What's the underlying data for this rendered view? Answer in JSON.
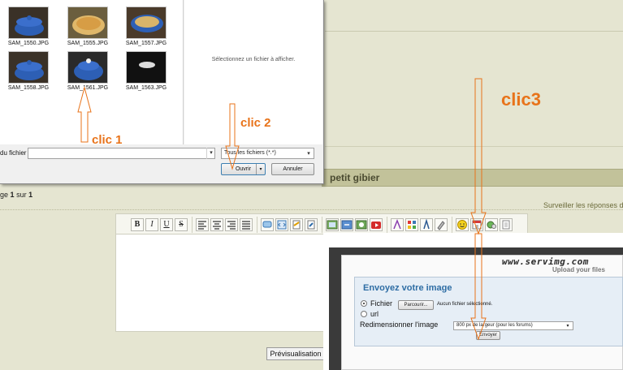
{
  "dialog": {
    "files": [
      {
        "name": "SAM_1550.JPG"
      },
      {
        "name": "SAM_1555.JPG"
      },
      {
        "name": "SAM_1557.JPG"
      },
      {
        "name": "SAM_1558.JPG"
      },
      {
        "name": "SAM_1561.JPG"
      },
      {
        "name": "SAM_1563.JPG"
      }
    ],
    "preview_text": "Sélectionnez un fichier à afficher.",
    "filename_label": "du fichier :",
    "filename_value": "",
    "filter_value": "Tous les fichiers (*.*)",
    "open_label": "Ouvrir",
    "cancel_label": "Annuler"
  },
  "forum": {
    "topic_title": "petit gibier",
    "page_prefix": "ge",
    "page_current": "1",
    "page_sep": "sur",
    "page_total": "1",
    "monitor_link": "Surveiller les réponses de",
    "preview_button": "Prévisualisation"
  },
  "toolbar": {
    "bold": "B",
    "italic": "I",
    "underline": "U",
    "strike": "S"
  },
  "servimg": {
    "logo": "www.servimg.com",
    "tagline": "Upload your files",
    "title": "Envoyez votre image",
    "file_option": "Fichier",
    "browse_button": "Parcourir...",
    "no_file": "Aucun fichier sélectionné.",
    "url_option": "url",
    "resize_label": "Redimensionner l'image",
    "resize_value": "800 px de largeur (pour les forums)",
    "send_button": "Envoyer"
  },
  "annotations": {
    "clic1": "clic 1",
    "clic2": "clic 2",
    "clic3": "clic3"
  }
}
